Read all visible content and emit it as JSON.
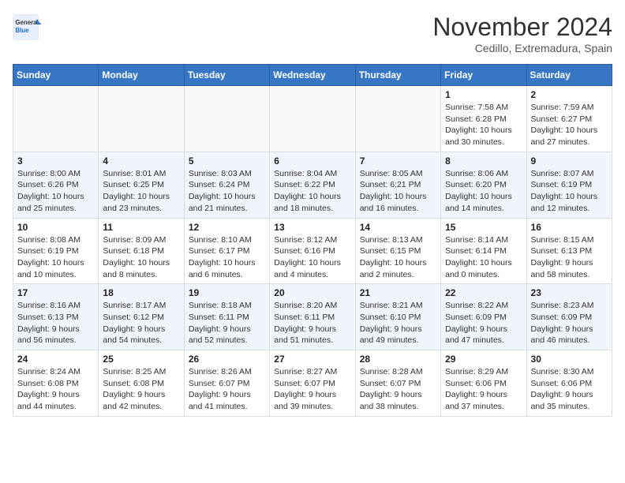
{
  "header": {
    "logo_general": "General",
    "logo_blue": "Blue",
    "month_title": "November 2024",
    "location": "Cedillo, Extremadura, Spain"
  },
  "weekdays": [
    "Sunday",
    "Monday",
    "Tuesday",
    "Wednesday",
    "Thursday",
    "Friday",
    "Saturday"
  ],
  "weeks": [
    [
      {
        "day": "",
        "info": ""
      },
      {
        "day": "",
        "info": ""
      },
      {
        "day": "",
        "info": ""
      },
      {
        "day": "",
        "info": ""
      },
      {
        "day": "",
        "info": ""
      },
      {
        "day": "1",
        "info": "Sunrise: 7:58 AM\nSunset: 6:28 PM\nDaylight: 10 hours and 30 minutes."
      },
      {
        "day": "2",
        "info": "Sunrise: 7:59 AM\nSunset: 6:27 PM\nDaylight: 10 hours and 27 minutes."
      }
    ],
    [
      {
        "day": "3",
        "info": "Sunrise: 8:00 AM\nSunset: 6:26 PM\nDaylight: 10 hours and 25 minutes."
      },
      {
        "day": "4",
        "info": "Sunrise: 8:01 AM\nSunset: 6:25 PM\nDaylight: 10 hours and 23 minutes."
      },
      {
        "day": "5",
        "info": "Sunrise: 8:03 AM\nSunset: 6:24 PM\nDaylight: 10 hours and 21 minutes."
      },
      {
        "day": "6",
        "info": "Sunrise: 8:04 AM\nSunset: 6:22 PM\nDaylight: 10 hours and 18 minutes."
      },
      {
        "day": "7",
        "info": "Sunrise: 8:05 AM\nSunset: 6:21 PM\nDaylight: 10 hours and 16 minutes."
      },
      {
        "day": "8",
        "info": "Sunrise: 8:06 AM\nSunset: 6:20 PM\nDaylight: 10 hours and 14 minutes."
      },
      {
        "day": "9",
        "info": "Sunrise: 8:07 AM\nSunset: 6:19 PM\nDaylight: 10 hours and 12 minutes."
      }
    ],
    [
      {
        "day": "10",
        "info": "Sunrise: 8:08 AM\nSunset: 6:19 PM\nDaylight: 10 hours and 10 minutes."
      },
      {
        "day": "11",
        "info": "Sunrise: 8:09 AM\nSunset: 6:18 PM\nDaylight: 10 hours and 8 minutes."
      },
      {
        "day": "12",
        "info": "Sunrise: 8:10 AM\nSunset: 6:17 PM\nDaylight: 10 hours and 6 minutes."
      },
      {
        "day": "13",
        "info": "Sunrise: 8:12 AM\nSunset: 6:16 PM\nDaylight: 10 hours and 4 minutes."
      },
      {
        "day": "14",
        "info": "Sunrise: 8:13 AM\nSunset: 6:15 PM\nDaylight: 10 hours and 2 minutes."
      },
      {
        "day": "15",
        "info": "Sunrise: 8:14 AM\nSunset: 6:14 PM\nDaylight: 10 hours and 0 minutes."
      },
      {
        "day": "16",
        "info": "Sunrise: 8:15 AM\nSunset: 6:13 PM\nDaylight: 9 hours and 58 minutes."
      }
    ],
    [
      {
        "day": "17",
        "info": "Sunrise: 8:16 AM\nSunset: 6:13 PM\nDaylight: 9 hours and 56 minutes."
      },
      {
        "day": "18",
        "info": "Sunrise: 8:17 AM\nSunset: 6:12 PM\nDaylight: 9 hours and 54 minutes."
      },
      {
        "day": "19",
        "info": "Sunrise: 8:18 AM\nSunset: 6:11 PM\nDaylight: 9 hours and 52 minutes."
      },
      {
        "day": "20",
        "info": "Sunrise: 8:20 AM\nSunset: 6:11 PM\nDaylight: 9 hours and 51 minutes."
      },
      {
        "day": "21",
        "info": "Sunrise: 8:21 AM\nSunset: 6:10 PM\nDaylight: 9 hours and 49 minutes."
      },
      {
        "day": "22",
        "info": "Sunrise: 8:22 AM\nSunset: 6:09 PM\nDaylight: 9 hours and 47 minutes."
      },
      {
        "day": "23",
        "info": "Sunrise: 8:23 AM\nSunset: 6:09 PM\nDaylight: 9 hours and 46 minutes."
      }
    ],
    [
      {
        "day": "24",
        "info": "Sunrise: 8:24 AM\nSunset: 6:08 PM\nDaylight: 9 hours and 44 minutes."
      },
      {
        "day": "25",
        "info": "Sunrise: 8:25 AM\nSunset: 6:08 PM\nDaylight: 9 hours and 42 minutes."
      },
      {
        "day": "26",
        "info": "Sunrise: 8:26 AM\nSunset: 6:07 PM\nDaylight: 9 hours and 41 minutes."
      },
      {
        "day": "27",
        "info": "Sunrise: 8:27 AM\nSunset: 6:07 PM\nDaylight: 9 hours and 39 minutes."
      },
      {
        "day": "28",
        "info": "Sunrise: 8:28 AM\nSunset: 6:07 PM\nDaylight: 9 hours and 38 minutes."
      },
      {
        "day": "29",
        "info": "Sunrise: 8:29 AM\nSunset: 6:06 PM\nDaylight: 9 hours and 37 minutes."
      },
      {
        "day": "30",
        "info": "Sunrise: 8:30 AM\nSunset: 6:06 PM\nDaylight: 9 hours and 35 minutes."
      }
    ]
  ]
}
